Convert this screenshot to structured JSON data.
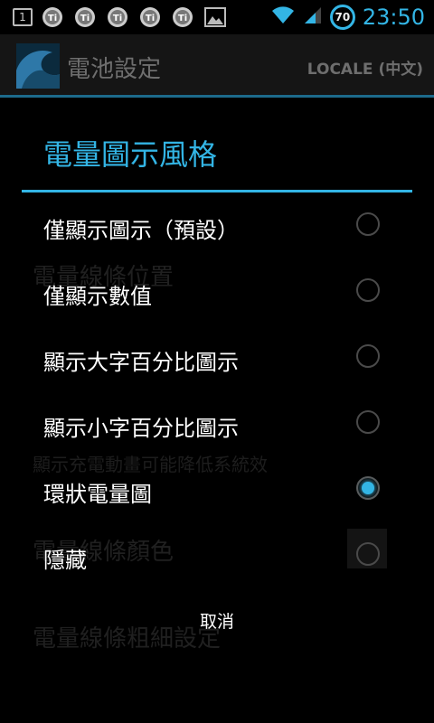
{
  "status_bar": {
    "notification_box": "1",
    "notification_icons": [
      "ti-icon",
      "ti-icon",
      "ti-icon",
      "ti-icon",
      "ti-icon",
      "image-icon"
    ],
    "battery_level": "70",
    "time": "23:50",
    "accent": "#33b5e5"
  },
  "action_bar": {
    "title": "電池設定",
    "locale": "LOCALE (中文)"
  },
  "background_list": {
    "items": [
      "電量線條位置",
      "電量線條顏色",
      "電量線條粗細設定"
    ],
    "subtext": "顯示充電動畫可能降低系統效"
  },
  "dialog": {
    "title": "電量圖示風格",
    "options": [
      {
        "label": "僅顯示圖示（預設）",
        "checked": false
      },
      {
        "label": "僅顯示數值",
        "checked": false
      },
      {
        "label": "顯示大字百分比圖示",
        "checked": false
      },
      {
        "label": "顯示小字百分比圖示",
        "checked": false
      },
      {
        "label": "環狀電量圖",
        "checked": true
      },
      {
        "label": "隱藏",
        "checked": false
      }
    ],
    "cancel": "取消"
  }
}
